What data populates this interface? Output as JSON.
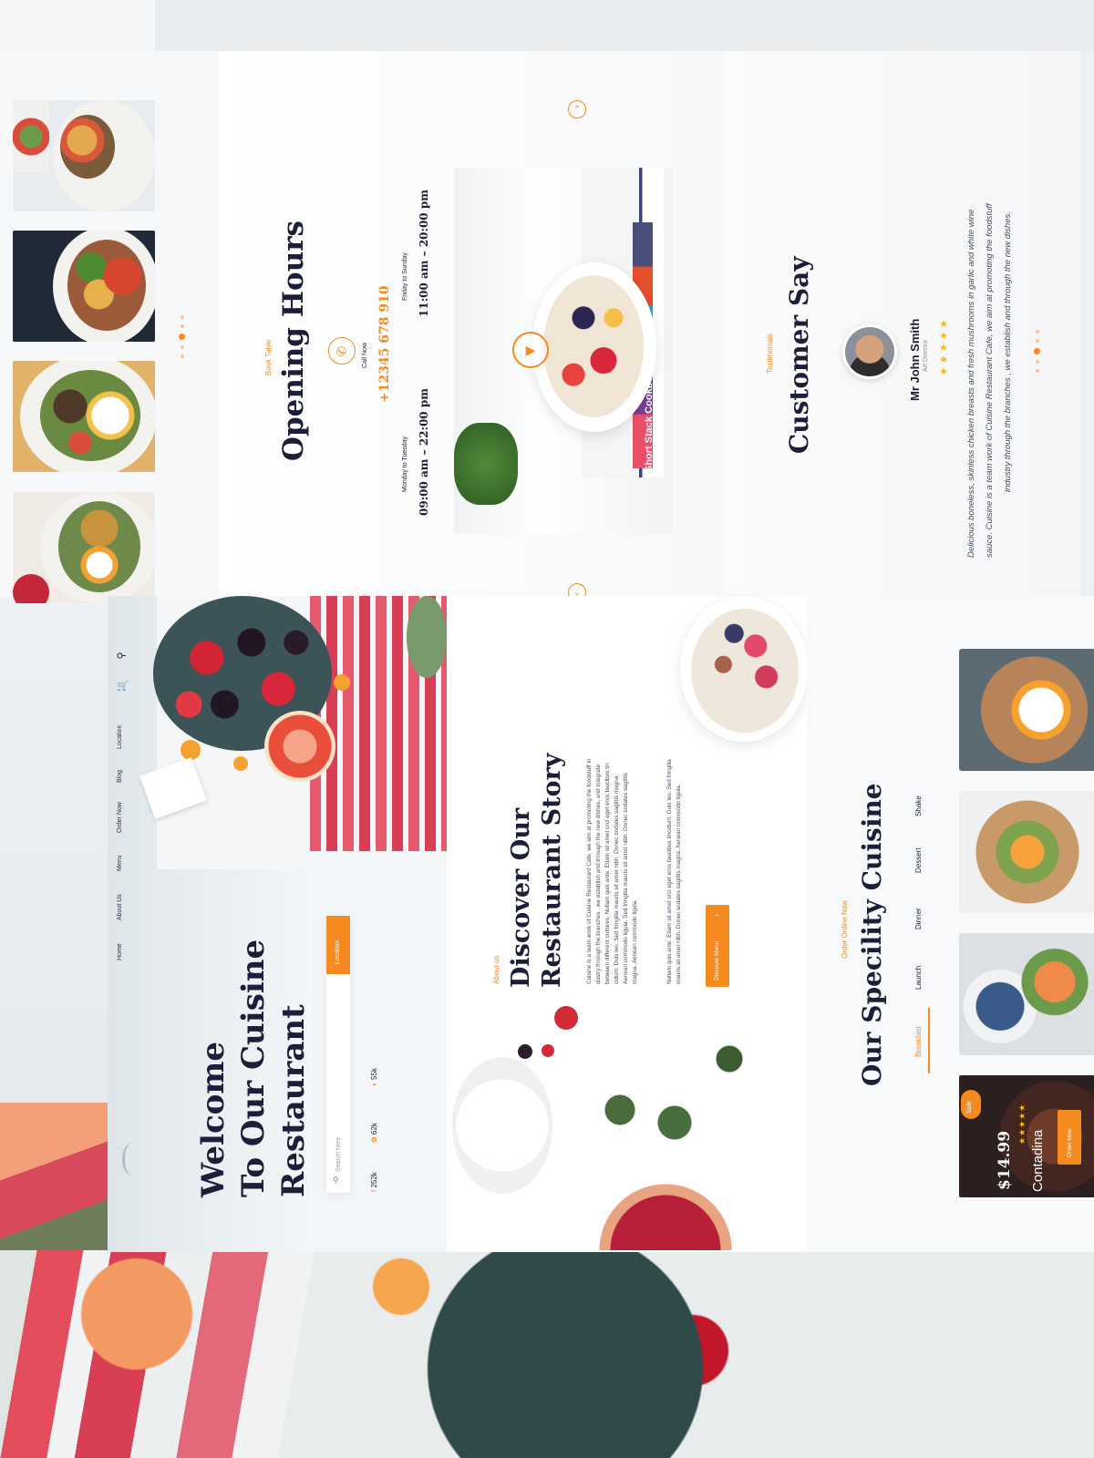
{
  "colors": {
    "accent": "#f58a1f",
    "navy": "#1d1f3a",
    "star": "#f6b81c"
  },
  "thumbnails": {
    "count": 4,
    "active_dot": 2
  },
  "hours": {
    "kicker": "Book Table",
    "title": "Opening Hours",
    "call_label": "Call Now",
    "phone": "+12345 678 910",
    "weekday_label": "Monday to Tuesday",
    "weekday_time": "09:00 am – 22:00 pm",
    "weekend_label": "Friday to Sunday",
    "weekend_time": "11:00 am – 20:00 pm",
    "book_spine_text": "Short Stack Cookbook",
    "phone_icon": "phone-icon",
    "play_icon": "play-icon"
  },
  "testimonials": {
    "kicker": "Testimonials",
    "title": "Customer Say",
    "name": "Mr John Smith",
    "role": "Art Director",
    "rating": 5,
    "quote_line1": "Delicious boneless, skinless chicken breasts and fresh mushrooms in garlic and white wine",
    "quote_line2": "sauce. Cuisine is a team work of Cuisine Restaurant Cafe, we aim at promoting the foodstuff",
    "quote_line3": "industry through the branches , we establish and through the new dishes."
  },
  "nav": {
    "items": [
      "Home",
      "About Us",
      "Menu",
      "Order Now",
      "Blog",
      "Location"
    ]
  },
  "hero": {
    "title_line1": "Welcome",
    "title_line2": "To Our Cuisine",
    "title_line3": "Restaurant",
    "search_placeholder": "Search here",
    "location_label": "Location",
    "social": {
      "facebook": "252k",
      "twitter": "62k",
      "instagram": "55k"
    }
  },
  "about": {
    "kicker": "About us",
    "title_line1": "Discover Our",
    "title_line2": "Restaurant Story",
    "p1_lines": [
      "Cuisine is a team work of Cuisine Restaurant Cafe, we aim at promoting the foodstuff in",
      "dustry through the branches , we establish and through the new dishes, and integrate",
      "between different cultures. Nullam quis ante. Etiam sit amet orci eget eros faucibus tin",
      "cidunt. Duis leo. Sed fringilla mauris sit amet nibh. Donec sodales sagittis magna.",
      "Aenean commodo ligula. Sed fringilla mauris sit amet nibh. Donec sodales sagittis",
      "magna. Aenean commodo ligula."
    ],
    "p2_lines": [
      "Nullam quis ante. Etiam sit amet orci eget eros faucibus tincidunt. Duis leo. Sed fringilla",
      "mauris sit amet nibh. Donec sodales sagittis magna. Aenean commodo ligula."
    ],
    "button_label": "Discover Menu"
  },
  "specialty": {
    "kicker": "Order Online Now",
    "title": "Our Specility Cuisine",
    "tabs": [
      "Breakfast",
      "Launch",
      "Dinner",
      "Dessert",
      "Shake"
    ],
    "active_tab": 0,
    "promo": {
      "badge": "Sale",
      "price": "$14.99",
      "name": "Contadina",
      "rating": 5,
      "button_label": "Order Now"
    }
  }
}
